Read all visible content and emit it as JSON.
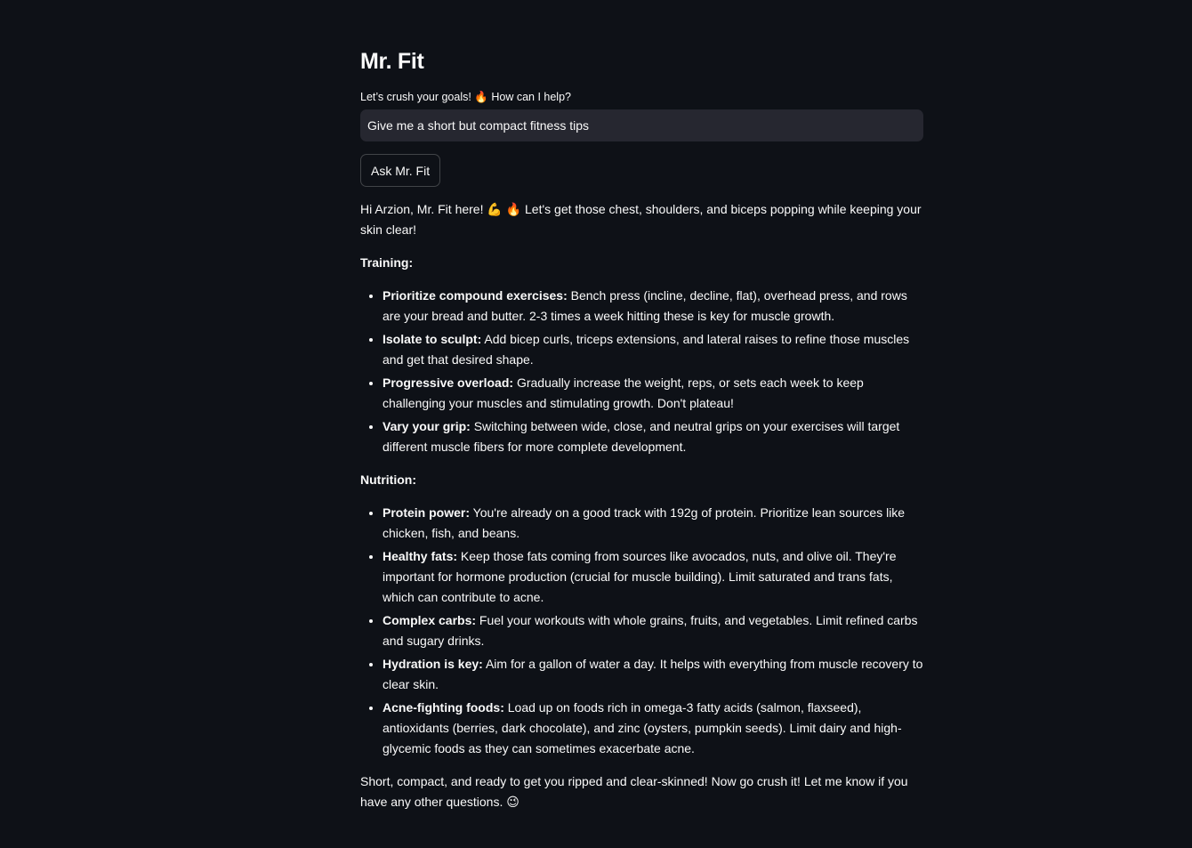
{
  "app": {
    "title": "Mr. Fit"
  },
  "prompt": {
    "label": "Let’s crush your goals! 🔥 How can I help?",
    "value": "Give me a short but compact fitness tips"
  },
  "button": {
    "label": "Ask Mr. Fit"
  },
  "response": {
    "intro": "Hi Arzion, Mr. Fit here! 💪 🔥 Let's get those chest, shoulders, and biceps popping while keeping your skin clear!",
    "training_heading": "Training:",
    "training": [
      {
        "bold": "Prioritize compound exercises:",
        "text": " Bench press (incline, decline, flat), overhead press, and rows are your bread and butter. 2-3 times a week hitting these is key for muscle growth."
      },
      {
        "bold": "Isolate to sculpt:",
        "text": " Add bicep curls, triceps extensions, and lateral raises to refine those muscles and get that desired shape."
      },
      {
        "bold": "Progressive overload:",
        "text": " Gradually increase the weight, reps, or sets each week to keep challenging your muscles and stimulating growth. Don't plateau!"
      },
      {
        "bold": "Vary your grip:",
        "text": " Switching between wide, close, and neutral grips on your exercises will target different muscle fibers for more complete development."
      }
    ],
    "nutrition_heading": "Nutrition:",
    "nutrition": [
      {
        "bold": "Protein power:",
        "text": " You're already on a good track with 192g of protein. Prioritize lean sources like chicken, fish, and beans."
      },
      {
        "bold": "Healthy fats:",
        "text": " Keep those fats coming from sources like avocados, nuts, and olive oil. They're important for hormone production (crucial for muscle building). Limit saturated and trans fats, which can contribute to acne."
      },
      {
        "bold": "Complex carbs:",
        "text": " Fuel your workouts with whole grains, fruits, and vegetables. Limit refined carbs and sugary drinks."
      },
      {
        "bold": "Hydration is key:",
        "text": " Aim for a gallon of water a day. It helps with everything from muscle recovery to clear skin."
      },
      {
        "bold": "Acne-fighting foods:",
        "text": " Load up on foods rich in omega-3 fatty acids (salmon, flaxseed), antioxidants (berries, dark chocolate), and zinc (oysters, pumpkin seeds). Limit dairy and high-glycemic foods as they can sometimes exacerbate acne."
      }
    ],
    "closing": "Short, compact, and ready to get you ripped and clear-skinned! Now go crush it! Let me know if you have any other questions. 😉"
  },
  "colors": {
    "background": "#0e1117",
    "text": "#fafafa",
    "input_bg": "#262730"
  }
}
